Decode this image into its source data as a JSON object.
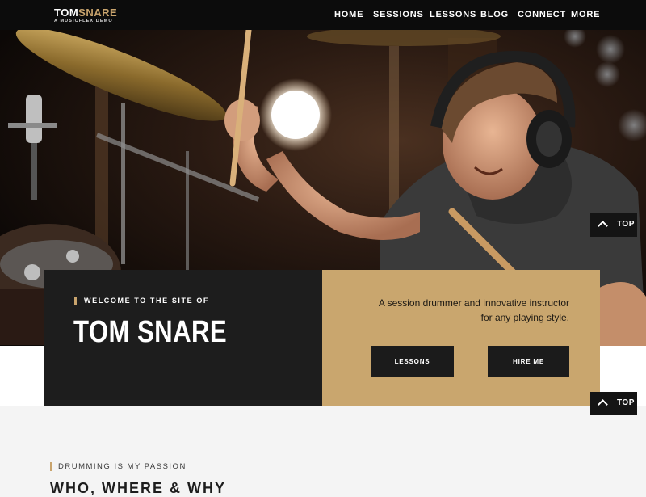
{
  "brand": {
    "name_part1": "TOM",
    "name_part2": "SNARE",
    "subtitle": "A MUSICFLEX DEMO"
  },
  "nav": {
    "items": [
      {
        "label": "HOME"
      },
      {
        "label": "SESSIONS"
      },
      {
        "label": "LESSONS"
      },
      {
        "label": "BLOG"
      },
      {
        "label": "CONNECT"
      },
      {
        "label": "MORE"
      }
    ]
  },
  "intro": {
    "eyebrow": "WELCOME TO THE SITE OF",
    "title": "TOM SNARE",
    "tagline": "A session drummer and innovative instructor for any playing style.",
    "buttons": {
      "lessons": "LESSONS",
      "hire": "HIRE ME"
    }
  },
  "back_to_top": {
    "label": "TOP"
  },
  "passion_section": {
    "eyebrow": "DRUMMING IS MY PASSION",
    "title": "WHO, WHERE & WHY"
  },
  "colors": {
    "accent": "#c9a46d",
    "dark": "#1d1d1d",
    "header": "#0c0c0c"
  }
}
